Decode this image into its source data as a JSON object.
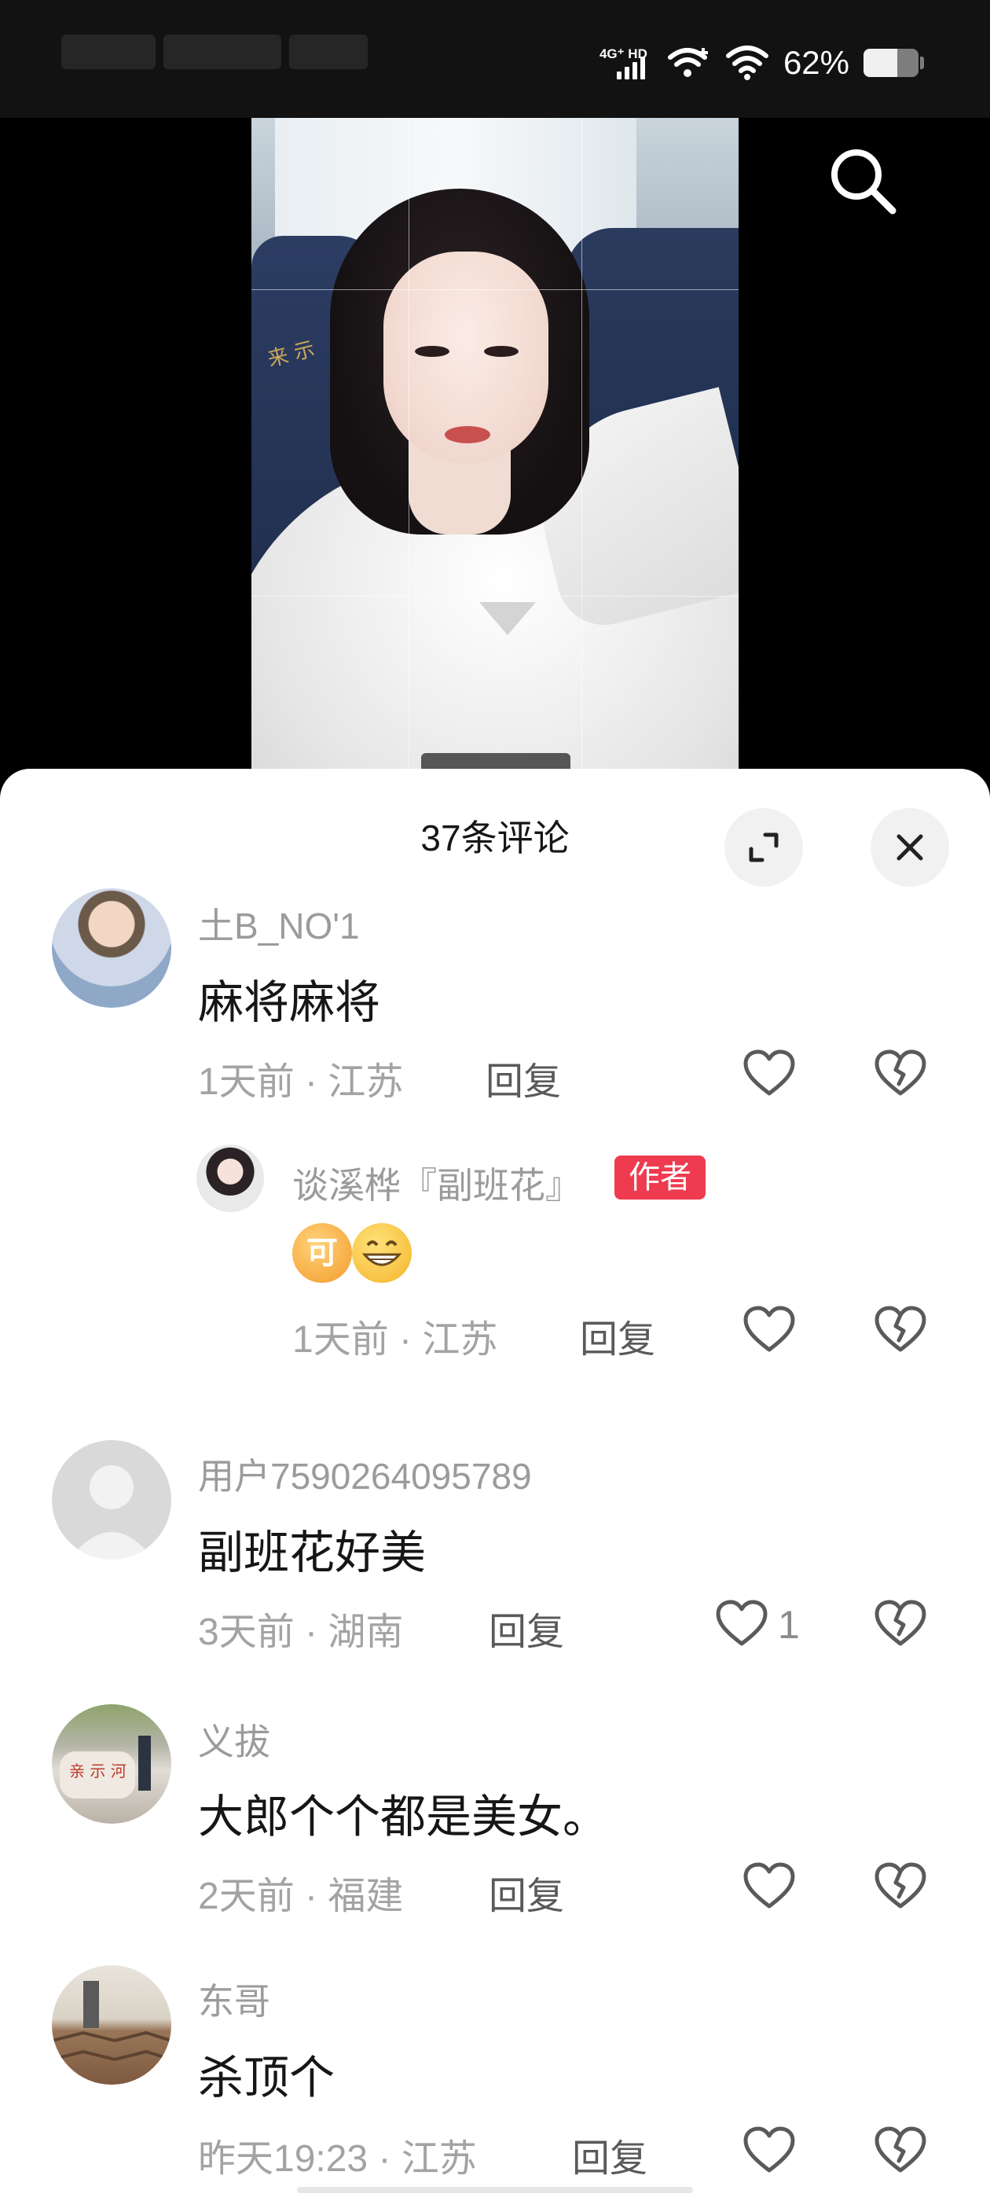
{
  "status_bar": {
    "network_label": "4G⁺ HD",
    "battery_percent": "62%",
    "battery_level": 0.62,
    "icons": [
      "signal-icon",
      "wifi-plus-icon",
      "wifi-icon",
      "battery-icon"
    ]
  },
  "video": {
    "search_icon": "search-icon"
  },
  "comments_panel": {
    "title": "37条评论",
    "expand_icon": "expand-icon",
    "close_icon": "close-icon"
  },
  "comments": [
    {
      "username": "土B_NO'1",
      "text": "麻将麻将",
      "meta": "1天前 · 江苏",
      "reply_label": "回复",
      "like_count": ""
    },
    {
      "username": "谈溪桦『副班花』",
      "badge": "作者",
      "emojis": [
        "可",
        "grin-emoji"
      ],
      "meta": "1天前 · 江苏",
      "reply_label": "回复",
      "like_count": ""
    },
    {
      "username": "用户7590264095789",
      "text": "副班花好美",
      "meta": "3天前 · 湖南",
      "reply_label": "回复",
      "like_count": "1"
    },
    {
      "username": "义拔",
      "text": "大郎个个都是美女。",
      "meta": "2天前 · 福建",
      "reply_label": "回复",
      "like_count": ""
    },
    {
      "username": "东哥",
      "text": "杀顶个",
      "meta": "昨天19:23 · 江苏",
      "reply_label": "回复",
      "like_count": ""
    }
  ],
  "colors": {
    "author_badge": "#ef3b4f",
    "meta_text": "#a3a3a3",
    "sheet_bg": "#ffffff"
  }
}
